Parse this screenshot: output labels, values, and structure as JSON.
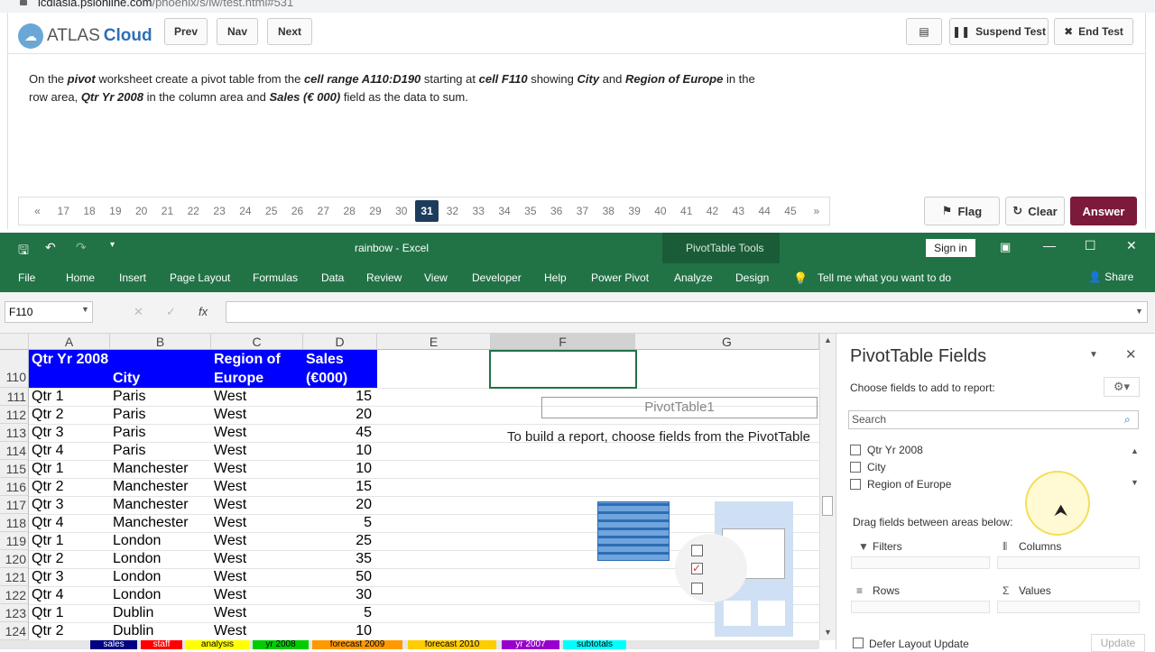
{
  "browser": {
    "url_host": "icdlasia.psionline.com",
    "url_path": "/phoenix/s/iw/test.html#531"
  },
  "header": {
    "logo_left": "ATLAS",
    "logo_right": "Cloud",
    "prev": "Prev",
    "nav": "Nav",
    "next": "Next",
    "suspend": "Suspend Test",
    "end": "End Test"
  },
  "instruction": {
    "parts": [
      "On the ",
      "pivot",
      " worksheet create a pivot table from the ",
      "cell range A110:D190",
      " starting at ",
      "cell F110",
      " showing ",
      "City",
      " and ",
      "Region of Europe",
      " in the row area, ",
      "Qtr Yr 2008",
      " in the column area and ",
      "Sales (€ 000)",
      " field as the data to sum."
    ]
  },
  "pager": {
    "first": "«",
    "last": "»",
    "pages": [
      "17",
      "18",
      "19",
      "20",
      "21",
      "22",
      "23",
      "24",
      "25",
      "26",
      "27",
      "28",
      "29",
      "30",
      "31",
      "32",
      "33",
      "34",
      "35",
      "36",
      "37",
      "38",
      "39",
      "40",
      "41",
      "42",
      "43",
      "44",
      "45"
    ],
    "current": "31"
  },
  "actions": {
    "flag": "Flag",
    "clear": "Clear",
    "answer": "Answer"
  },
  "excel": {
    "doc_title": "rainbow  -  Excel",
    "tools": "PivotTable Tools",
    "signin": "Sign in",
    "tabs": [
      "File",
      "Home",
      "Insert",
      "Page Layout",
      "Formulas",
      "Data",
      "Review",
      "View",
      "Developer",
      "Help",
      "Power Pivot",
      "Analyze",
      "Design"
    ],
    "tell": "Tell me what you want to do",
    "share": "Share",
    "namebox": "F110",
    "fx": "fx",
    "cols": [
      "A",
      "B",
      "C",
      "D",
      "E",
      "F",
      "G"
    ],
    "header_row": {
      "num": "110",
      "a": "Qtr Yr 2008",
      "b": "City",
      "c": "Region of Europe",
      "d": "Sales (€000)"
    },
    "rows": [
      {
        "n": "111",
        "a": "Qtr 1",
        "b": "Paris",
        "c": "West",
        "d": "15"
      },
      {
        "n": "112",
        "a": "Qtr 2",
        "b": "Paris",
        "c": "West",
        "d": "20"
      },
      {
        "n": "113",
        "a": "Qtr 3",
        "b": "Paris",
        "c": "West",
        "d": "45"
      },
      {
        "n": "114",
        "a": "Qtr 4",
        "b": "Paris",
        "c": "West",
        "d": "10"
      },
      {
        "n": "115",
        "a": "Qtr 1",
        "b": "Manchester",
        "c": "West",
        "d": "10"
      },
      {
        "n": "116",
        "a": "Qtr 2",
        "b": "Manchester",
        "c": "West",
        "d": "15"
      },
      {
        "n": "117",
        "a": "Qtr 3",
        "b": "Manchester",
        "c": "West",
        "d": "20"
      },
      {
        "n": "118",
        "a": "Qtr 4",
        "b": "Manchester",
        "c": "West",
        "d": "5"
      },
      {
        "n": "119",
        "a": "Qtr 1",
        "b": "London",
        "c": "West",
        "d": "25"
      },
      {
        "n": "120",
        "a": "Qtr 2",
        "b": "London",
        "c": "West",
        "d": "35"
      },
      {
        "n": "121",
        "a": "Qtr 3",
        "b": "London",
        "c": "West",
        "d": "50"
      },
      {
        "n": "122",
        "a": "Qtr 4",
        "b": "London",
        "c": "West",
        "d": "30"
      },
      {
        "n": "123",
        "a": "Qtr 1",
        "b": "Dublin",
        "c": "West",
        "d": "5"
      },
      {
        "n": "124",
        "a": "Qtr 2",
        "b": "Dublin",
        "c": "West",
        "d": "10"
      }
    ],
    "pivot_name": "PivotTable1",
    "pivot_msg": "To build a report, choose fields from the PivotTable",
    "sheet_tabs": [
      {
        "label": "sales",
        "color": "#000080",
        "fg": "#ffffff"
      },
      {
        "label": "staff",
        "color": "#ff0000",
        "fg": "#ffffff"
      },
      {
        "label": "analysis",
        "color": "#ffff00",
        "fg": "#000000"
      },
      {
        "label": "yr 2008",
        "color": "#00cc00",
        "fg": "#000000"
      },
      {
        "label": "forecast 2009",
        "color": "#ff9900",
        "fg": "#000000"
      },
      {
        "label": "forecast 2010",
        "color": "#ffcc00",
        "fg": "#000000"
      },
      {
        "label": "yr 2007",
        "color": "#9900cc",
        "fg": "#ffffff"
      },
      {
        "label": "subtotals",
        "color": "#00ffff",
        "fg": "#000000"
      }
    ]
  },
  "panel": {
    "title": "PivotTable Fields",
    "choose": "Choose fields to add to report:",
    "search": "Search",
    "fields": [
      "Qtr Yr 2008",
      "City",
      "Region of Europe"
    ],
    "drag": "Drag fields between areas below:",
    "filters": "Filters",
    "columns": "Columns",
    "rows": "Rows",
    "values": "Values",
    "defer": "Defer Layout Update",
    "update": "Update"
  }
}
